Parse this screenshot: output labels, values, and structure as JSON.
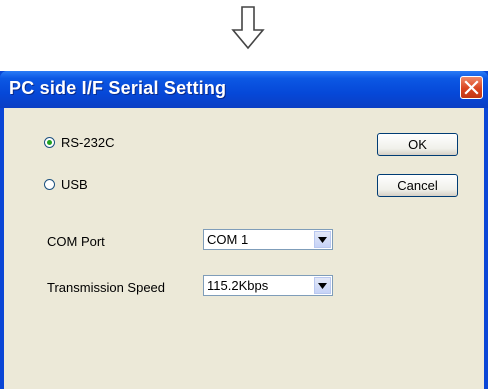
{
  "dialog": {
    "title": "PC side I/F Serial Setting",
    "radios": [
      {
        "label": "RS-232C",
        "checked": true
      },
      {
        "label": "USB",
        "checked": false
      }
    ],
    "ok_label": "OK",
    "cancel_label": "Cancel",
    "com_port": {
      "label": "COM Port",
      "value": "COM 1"
    },
    "transmission_speed": {
      "label": "Transmission Speed",
      "value": "115.2Kbps"
    }
  },
  "icons": {
    "top_arrow": "down-arrow-icon",
    "close": "close-icon",
    "dropdown": "chevron-down-icon"
  },
  "colors": {
    "titlebar": "#0648d8",
    "close_button": "#d9441f",
    "dialog_background": "#ece9d8",
    "radio_dot": "#21a121"
  }
}
